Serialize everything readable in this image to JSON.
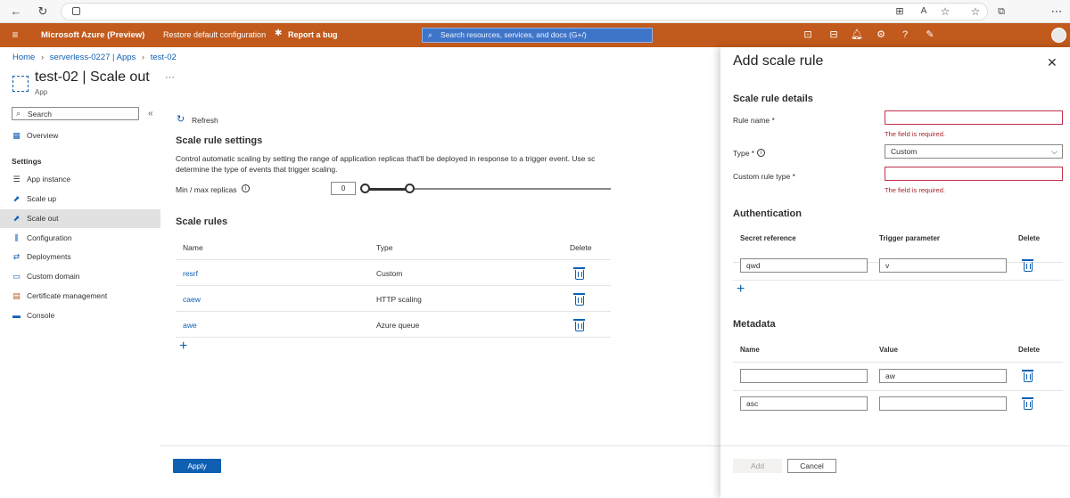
{
  "topbar": {
    "brand": "Microsoft Azure (Preview)",
    "restore": "Restore default configuration",
    "report_bug": "Report a bug",
    "search_placeholder": "Search resources, services, and docs (G+/)"
  },
  "breadcrumb": {
    "items": [
      "Home",
      "serverless-0227 | Apps",
      "test-02"
    ]
  },
  "page": {
    "title": "test-02 | Scale out",
    "subtitle": "App",
    "more": "···"
  },
  "sidebar": {
    "search_placeholder": "Search",
    "collapse": "«",
    "overview": "Overview",
    "settings_heading": "Settings",
    "items": [
      "App instance",
      "Scale up",
      "Scale out",
      "Configuration",
      "Deployments",
      "Custom domain",
      "Certificate management",
      "Console"
    ]
  },
  "main": {
    "refresh": "Refresh",
    "settings_heading": "Scale rule settings",
    "description_1": "Control automatic scaling by setting the range of application replicas that'll be deployed in response to a trigger event. Use sc",
    "description_2": "determine the type of events that trigger scaling.",
    "replicas_label": "Min / max replicas",
    "replicas_min": "0",
    "replicas_slider": {
      "min_fraction": 0,
      "max_fraction": 0.18
    },
    "rules_heading": "Scale rules",
    "columns": {
      "name": "Name",
      "type": "Type",
      "delete": "Delete"
    },
    "rules": [
      {
        "name": "resrf",
        "type": "Custom"
      },
      {
        "name": "caew",
        "type": "HTTP scaling"
      },
      {
        "name": "awe",
        "type": "Azure queue"
      }
    ],
    "apply": "Apply"
  },
  "panel": {
    "title": "Add scale rule",
    "details_heading": "Scale rule details",
    "rule_name_label": "Rule name *",
    "rule_name_value": "",
    "required_error": "The field is required.",
    "type_label": "Type *",
    "type_value": "Custom",
    "custom_type_label": "Custom rule type *",
    "custom_type_value": "",
    "auth_heading": "Authentication",
    "auth_columns": {
      "secret": "Secret reference",
      "trigger": "Trigger parameter",
      "delete": "Delete"
    },
    "auth_rows": [
      {
        "secret": "qwd",
        "trigger": "v"
      }
    ],
    "metadata_heading": "Metadata",
    "meta_columns": {
      "name": "Name",
      "value": "Value",
      "delete": "Delete"
    },
    "meta_rows": [
      {
        "name": "",
        "value": "aw"
      },
      {
        "name": "asc",
        "value": ""
      }
    ],
    "add": "Add",
    "cancel": "Cancel"
  },
  "colors": {
    "azure_orange": "#c15a1c",
    "link_blue": "#0f5fb3",
    "error_red": "#a4262c"
  }
}
